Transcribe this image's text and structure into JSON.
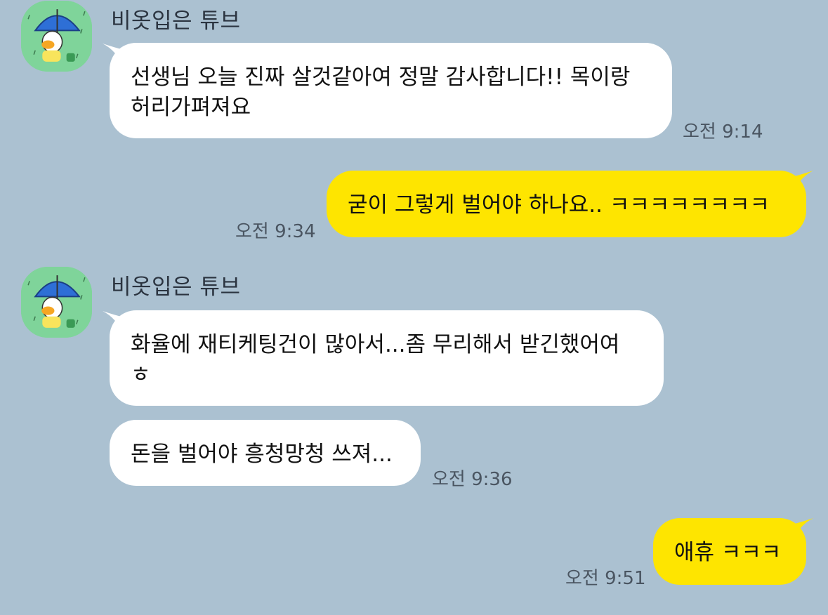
{
  "sender": {
    "name": "비옷입은 튜브"
  },
  "messages": [
    {
      "text": "선생님 오늘 진짜 살것같아여 정말 감사합니다!! 목이랑\n허리가펴져요",
      "time": "오전 9:14"
    },
    {
      "text": "굳이 그렇게 벌어야 하나요.. ㅋㅋㅋㅋㅋㅋㅋㅋ",
      "time": "오전 9:34"
    },
    {
      "text": "화율에 재티케팅건이 많아서...좀 무리해서 받긴했어여\nㅎ"
    },
    {
      "text": "돈을 벌어야 흥청망청 쓰져...",
      "time": "오전 9:36"
    },
    {
      "text": "애휴 ㅋㅋㅋ",
      "time": "오전 9:51"
    }
  ],
  "colors": {
    "background": "#abc1d1",
    "incoming_bubble": "#ffffff",
    "outgoing_bubble": "#fee500",
    "timestamp": "#4a5561",
    "sender_name": "#2b3440"
  },
  "icons": [
    "profile-avatar-tube-umbrella"
  ]
}
